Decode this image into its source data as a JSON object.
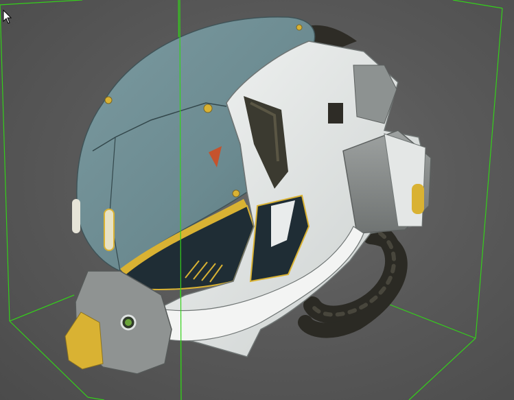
{
  "viewport": {
    "background": "#5a5a5a",
    "bounding_box_color": "#34d11a",
    "model": "sci-fi-helmet"
  },
  "colors": {
    "visor_shell": "#6f8e93",
    "white_plating": "#dfe3e2",
    "yellow_trim": "#d9b233",
    "dark_visor": "#1f2d35",
    "hose": "#2b2a24",
    "warning_triangle": "#c5532d"
  },
  "cursor": {
    "icon": "arrow-cursor-icon"
  }
}
